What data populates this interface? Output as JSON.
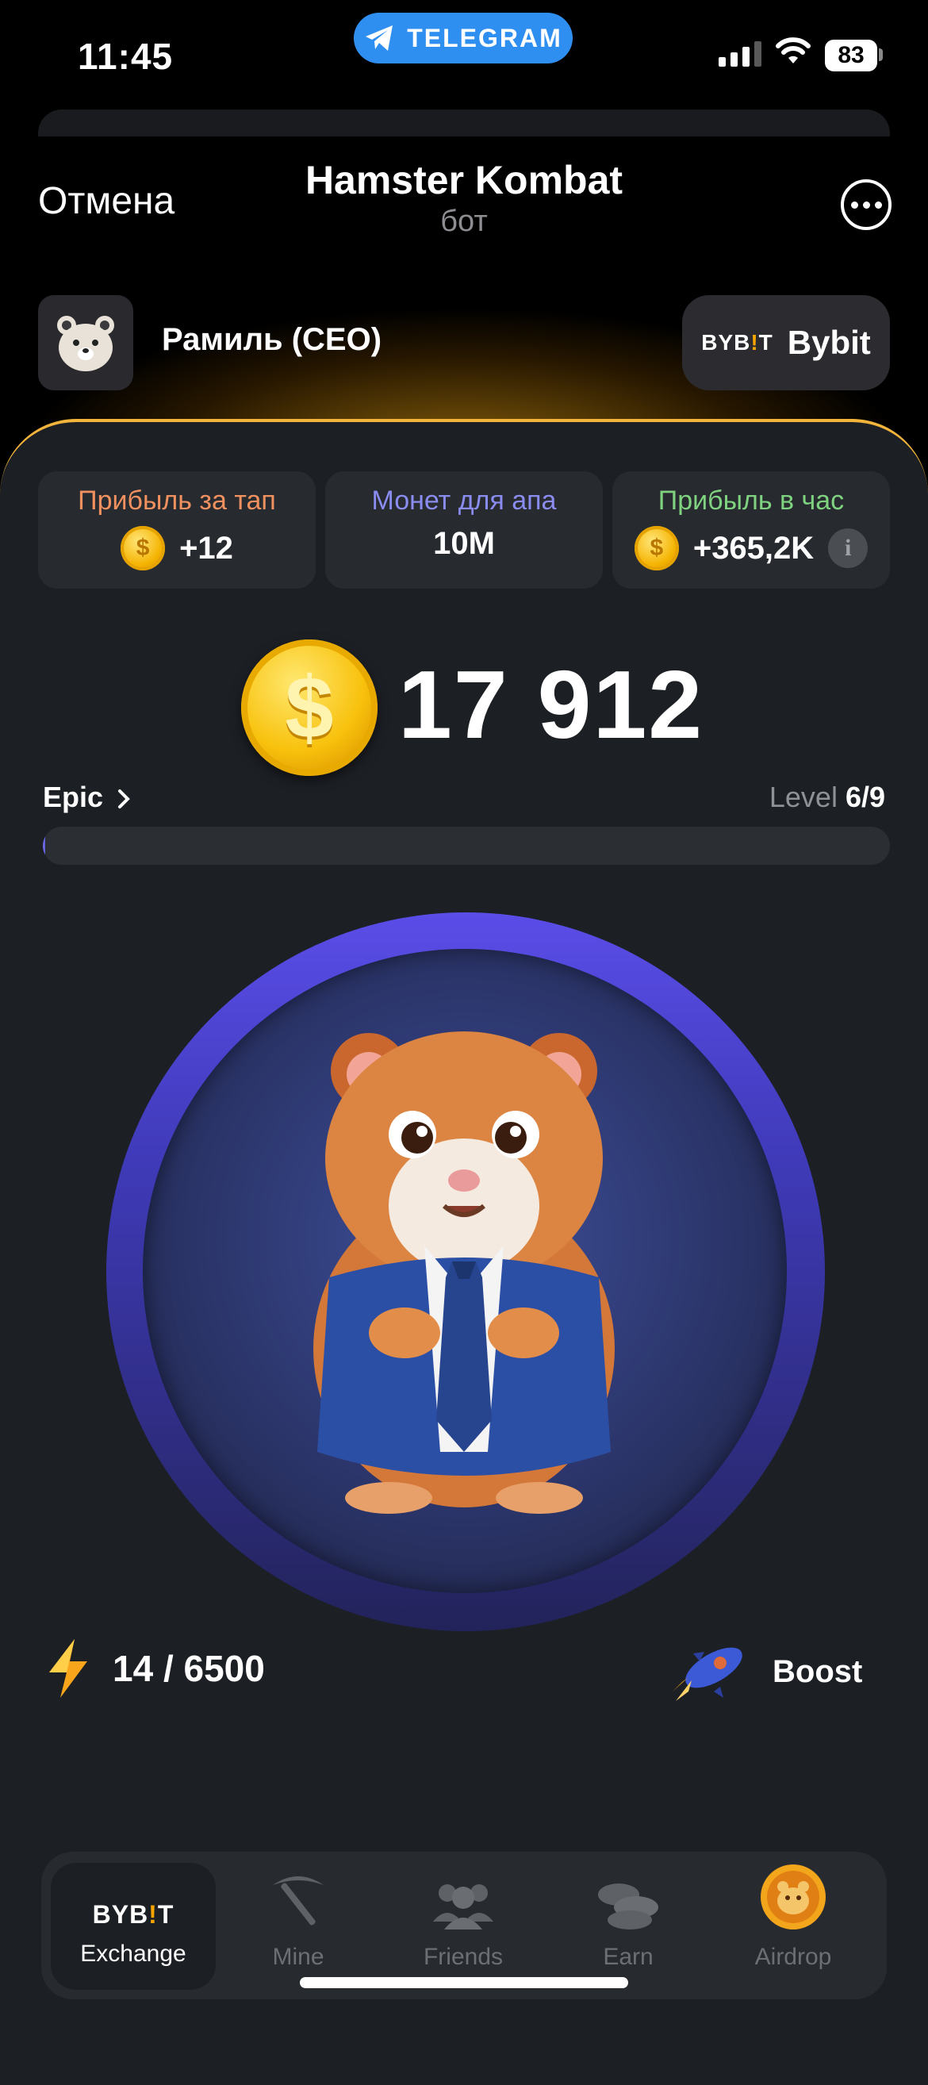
{
  "status_bar": {
    "time": "11:45",
    "app_pill": "TELEGRAM",
    "battery": "83"
  },
  "header": {
    "cancel_label": "Отмена",
    "title": "Hamster Kombat",
    "subtitle": "бот"
  },
  "user": {
    "name": "Рамиль (CEO)",
    "exchange_logo": "BYB!T",
    "exchange_label": "Bybit"
  },
  "stats": [
    {
      "label": "Прибыль за тап",
      "value": "+12",
      "label_color": "#f1915f",
      "icon": "coin-icon"
    },
    {
      "label": "Монет для апа",
      "value": "10M",
      "label_color": "#8a8cf0"
    },
    {
      "label": "Прибыль в час",
      "value": "+365,2K",
      "label_color": "#7fd27f",
      "icon": "coin-icon"
    }
  ],
  "balance": "17 912",
  "rank": {
    "name": "Epic",
    "level_label": "Level",
    "level_value": "6/9",
    "progress": 0.003
  },
  "energy": {
    "value": "14 / 6500"
  },
  "boost_label": "Boost",
  "nav": [
    {
      "label": "Exchange",
      "icon": "bybit-logo-icon",
      "active": true,
      "logo": "BYB!T"
    },
    {
      "label": "Mine",
      "icon": "pickaxe-icon"
    },
    {
      "label": "Friends",
      "icon": "friends-icon"
    },
    {
      "label": "Earn",
      "icon": "coins-icon"
    },
    {
      "label": "Airdrop",
      "icon": "hamster-coin-icon"
    }
  ],
  "colors": {
    "accent": "#f3b43c",
    "panel": "#1c1f24",
    "card": "#272a2f",
    "telegram": "#2f8ff0",
    "ring": "#5a4de8"
  }
}
